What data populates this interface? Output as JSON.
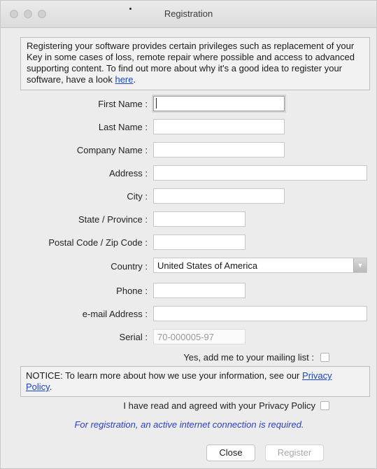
{
  "window": {
    "title": "Registration"
  },
  "intro": {
    "text": "Registering your software provides certain privileges such as replacement of your Key in some cases of loss, remote repair where possible and access to advanced supporting content. To find out more about why it's a good idea to register your software, have a look ",
    "link": "here",
    "end": "."
  },
  "form": {
    "first_name": "First Name :",
    "last_name": "Last Name :",
    "company": "Company Name :",
    "address": "Address :",
    "city": "City :",
    "state": "State / Province :",
    "postal": "Postal Code / Zip Code :",
    "country": "Country :",
    "country_value": "United States of America",
    "phone": "Phone :",
    "email": "e-mail Address :",
    "serial": "Serial :",
    "serial_value": "70-000005-97",
    "mailing_list": "Yes, add me to your mailing list :"
  },
  "notice": {
    "text": "NOTICE: To learn more about how we use your information, see our ",
    "link_part1": "Privacy",
    "link_part2": "Policy",
    "end": "."
  },
  "agree_label": "I have read and agreed with your Privacy Policy",
  "requirement": "For registration, an active internet connection is required.",
  "buttons": {
    "close": "Close",
    "register": "Register"
  },
  "colors": {
    "link": "#1a44c8",
    "requirement": "#2a3fc4",
    "window_bg": "#ececec"
  }
}
